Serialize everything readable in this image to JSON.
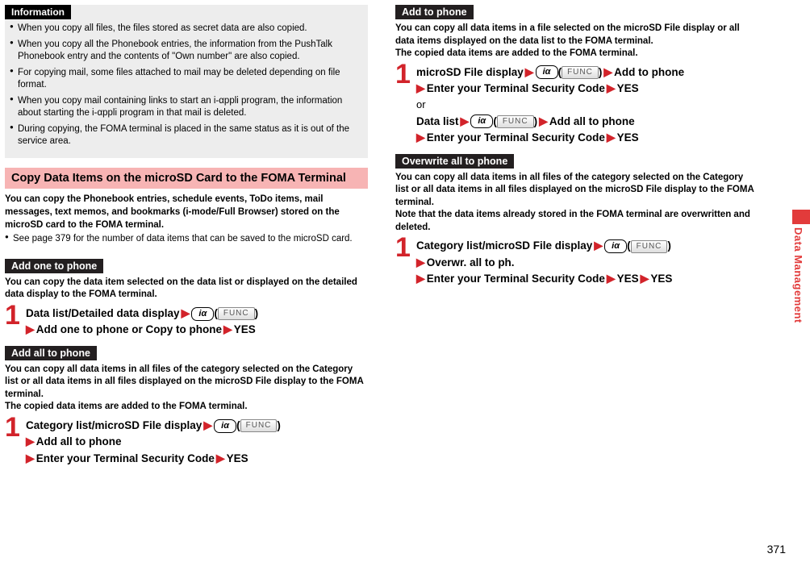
{
  "info": {
    "heading": "Information",
    "items": [
      "When you copy all files, the files stored as secret data are also copied.",
      "When you copy all the Phonebook entries, the information from the PushTalk Phonebook entry and the contents of \"Own number\" are also copied.",
      "For copying mail, some files attached to mail may be deleted depending on file format.",
      "When you copy mail containing links to start an i-αppli program, the information about starting the i-αppli program in that mail is deleted.",
      "During copying, the FOMA terminal is placed in the same status as it is out of the service area."
    ]
  },
  "pinkHeading": "Copy Data Items on the microSD Card to the FOMA Terminal",
  "intro": "You can copy the Phonebook entries, schedule events, ToDo items, mail messages, text memos, and bookmarks (i-mode/Full Browser) stored on the microSD card to the FOMA terminal.",
  "introNote": "See page 379 for the number of data items that can be saved to the microSD card.",
  "addOne": {
    "tab": "Add one to phone",
    "desc": "You can copy the data item selected on the data list or displayed on the detailed data display to the FOMA terminal.",
    "step1a": "Data list/Detailed data display",
    "step1b": "Add one to phone or Copy to phone",
    "yes": "YES"
  },
  "addAll": {
    "tab": "Add all to phone",
    "desc": "You can copy all data items in all files of the category selected on the Category list or all data items in all files displayed on the microSD File display to the FOMA terminal.",
    "desc2": "The copied data items are added to the FOMA terminal.",
    "step1a": "Category list/microSD File display",
    "step1b": "Add all to phone",
    "step1c": "Enter your Terminal Security Code",
    "yes": "YES"
  },
  "addTo": {
    "tab": "Add to phone",
    "desc": "You can copy all data items in a file selected on the microSD File display or all data items displayed on the data list to the FOMA terminal.",
    "desc2": "The copied data items are added to the FOMA terminal.",
    "p1a": "microSD File display",
    "p1b": "Add to phone",
    "p1c": "Enter your Terminal Security Code",
    "or": "or",
    "p2a": "Data list",
    "p2b": "Add all to phone",
    "p2c": "Enter your Terminal Security Code",
    "yes": "YES"
  },
  "overwrite": {
    "tab": "Overwrite all to phone",
    "desc": "You can copy all data items in all files of the category selected on the Category list or all data items in all files displayed on the microSD File display to the FOMA terminal.",
    "desc2": "Note that the data items already stored in the FOMA terminal are overwritten and deleted.",
    "step1a": "Category list/microSD File display",
    "step1b": "Overwr. all to ph.",
    "step1c": "Enter your Terminal Security Code",
    "yes": "YES"
  },
  "func": "FUNC",
  "key": "iα",
  "sideTab": "Data Management",
  "pageNum": "371"
}
